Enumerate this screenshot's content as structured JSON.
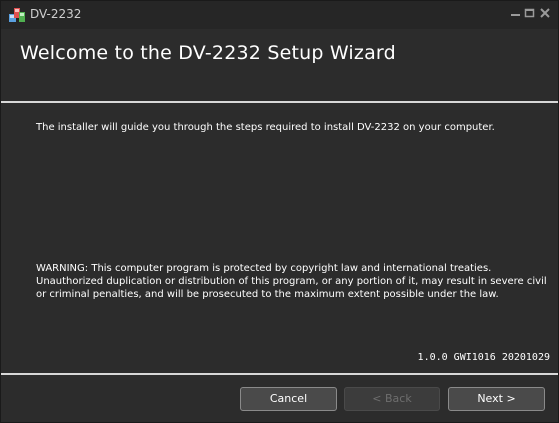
{
  "window": {
    "title": "DV-2232",
    "icon": "installer-app-icon"
  },
  "header": {
    "title": "Welcome to the DV-2232 Setup Wizard"
  },
  "body": {
    "intro": "The installer will guide you through the steps required to install DV-2232 on your computer.",
    "warning": "WARNING: This computer program is protected by copyright law and international treaties. Unauthorized duplication or distribution of this program, or any portion of it, may result in severe civil or criminal penalties, and will be prosecuted to the maximum extent possible under the law.",
    "version": "1.0.0 GWI1016 20201029"
  },
  "buttons": {
    "cancel": "Cancel",
    "back": "< Back",
    "next": "Next >"
  },
  "colors": {
    "window_bg": "#2c2c2c",
    "titlebar_bg": "#262626",
    "text": "#ffffff",
    "disabled_text": "#6e6e6e",
    "separator": "#d8d8d8"
  }
}
